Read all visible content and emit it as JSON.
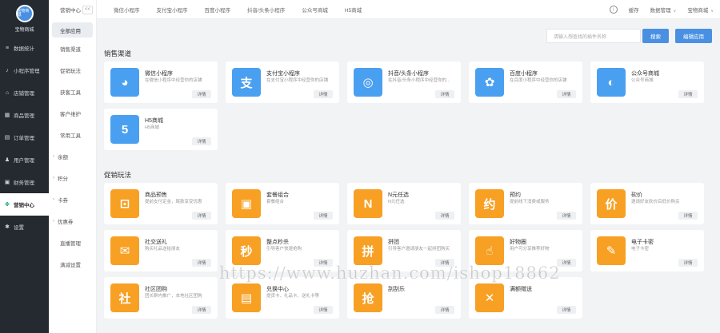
{
  "sidebar": {
    "logo_text": "宝物商城",
    "shop_name": "宝物商城",
    "items": [
      {
        "label": "数据统计",
        "icon": "chart-icon"
      },
      {
        "label": "小程序管理",
        "icon": "miniprogram-icon"
      },
      {
        "label": "店铺管理",
        "icon": "store-icon"
      },
      {
        "label": "商品管理",
        "icon": "goods-icon"
      },
      {
        "label": "订单管理",
        "icon": "order-icon"
      },
      {
        "label": "用户管理",
        "icon": "user-icon"
      },
      {
        "label": "财务管理",
        "icon": "finance-icon"
      },
      {
        "label": "营销中心",
        "icon": "marketing-icon",
        "active": true
      },
      {
        "label": "设置",
        "icon": "settings-icon"
      }
    ]
  },
  "subnav": {
    "header": "营销中心",
    "collapse": "<<",
    "items": [
      {
        "label": "全部应用",
        "active": true
      },
      {
        "label": "销售渠道"
      },
      {
        "label": "促销玩法"
      },
      {
        "label": "获客工具"
      },
      {
        "label": "客户维护"
      },
      {
        "label": "常用工具"
      },
      {
        "label": "余额",
        "arrow": true
      },
      {
        "label": "积分",
        "arrow": true
      },
      {
        "label": "卡券",
        "arrow": true
      },
      {
        "label": "优惠券",
        "arrow": true
      },
      {
        "label": "直播管理"
      },
      {
        "label": "满减设置"
      }
    ]
  },
  "topbar": {
    "tabs": [
      "微信小程序",
      "支付宝小程序",
      "百度小程序",
      "抖音/头条小程序",
      "公众号商城",
      "H5商城"
    ],
    "cache": "缓存",
    "admin": "数据管理",
    "store": "宝物商城"
  },
  "search": {
    "placeholder": "请输入想查找的插件名称",
    "button": "搜索",
    "apply": "编辑应用"
  },
  "sections": {
    "sales": "销售渠道",
    "promo": "促销玩法"
  },
  "detail_label": "详情",
  "sales_cards": [
    {
      "title": "微信小程序",
      "desc": "在微信小程序中经营你的店铺",
      "icon": "wechat-icon",
      "glyph": "◕",
      "color": "blue"
    },
    {
      "title": "支付宝小程序",
      "desc": "在支付宝小程序中经营你的店铺",
      "icon": "alipay-icon",
      "glyph": "支",
      "color": "blue"
    },
    {
      "title": "抖音/头条小程序",
      "desc": "在抖音/头条小程序中经营你的...",
      "icon": "douyin-icon",
      "glyph": "◎",
      "color": "blue"
    },
    {
      "title": "百度小程序",
      "desc": "在百度小程序中经营你的店铺",
      "icon": "baidu-icon",
      "glyph": "✿",
      "color": "blue"
    },
    {
      "title": "公众号商城",
      "desc": "公众号商城",
      "icon": "official-account-icon",
      "glyph": "◐",
      "color": "blue"
    },
    {
      "title": "H5商城",
      "desc": "H5商城",
      "icon": "html5-icon",
      "glyph": "5",
      "color": "blue"
    }
  ],
  "promo_cards": [
    {
      "title": "商品预售",
      "desc": "提前支付定金，尾款享受优惠",
      "icon": "presale-icon",
      "glyph": "⊡",
      "color": "orange"
    },
    {
      "title": "套餐组合",
      "desc": "套餐组合",
      "icon": "bundle-icon",
      "glyph": "▣",
      "color": "orange"
    },
    {
      "title": "N元任选",
      "desc": "N元任选",
      "icon": "n-yuan-icon",
      "glyph": "N",
      "color": "orange"
    },
    {
      "title": "预约",
      "desc": "提前线下消费或服务",
      "icon": "booking-icon",
      "glyph": "约",
      "color": "orange"
    },
    {
      "title": "砍价",
      "desc": "邀请好友砍价后低价购买",
      "icon": "bargain-icon",
      "glyph": "价",
      "color": "orange"
    },
    {
      "title": "社交送礼",
      "desc": "购买礼品送给朋友",
      "icon": "gift-icon",
      "glyph": "✉",
      "color": "orange"
    },
    {
      "title": "整点秒杀",
      "desc": "引导客户快速抢购",
      "icon": "seckill-icon",
      "glyph": "秒",
      "color": "orange"
    },
    {
      "title": "拼团",
      "desc": "引导客户邀请朋友一起拼团购买",
      "icon": "group-buy-icon",
      "glyph": "拼",
      "color": "orange"
    },
    {
      "title": "好物圈",
      "desc": "用户可分享推荐好物",
      "icon": "good-circle-icon",
      "glyph": "☝",
      "color": "orange"
    },
    {
      "title": "电子卡密",
      "desc": "电子卡密",
      "icon": "ecard-icon",
      "glyph": "✎",
      "color": "orange"
    },
    {
      "title": "社区团购",
      "desc": "团长群内推广，本地社区团购",
      "icon": "community-icon",
      "glyph": "社",
      "color": "orange"
    },
    {
      "title": "兑换中心",
      "desc": "提货卡、礼品卡、送礼卡等",
      "icon": "exchange-icon",
      "glyph": "▤",
      "color": "orange"
    },
    {
      "title": "刮刮乐",
      "desc": "",
      "icon": "scratch-icon",
      "glyph": "抢",
      "color": "orange"
    },
    {
      "title": "满额赠送",
      "desc": "",
      "icon": "gift-full-icon",
      "glyph": "✕",
      "color": "orange"
    }
  ],
  "watermark": "https://www.huzhan.com/ishop18862"
}
